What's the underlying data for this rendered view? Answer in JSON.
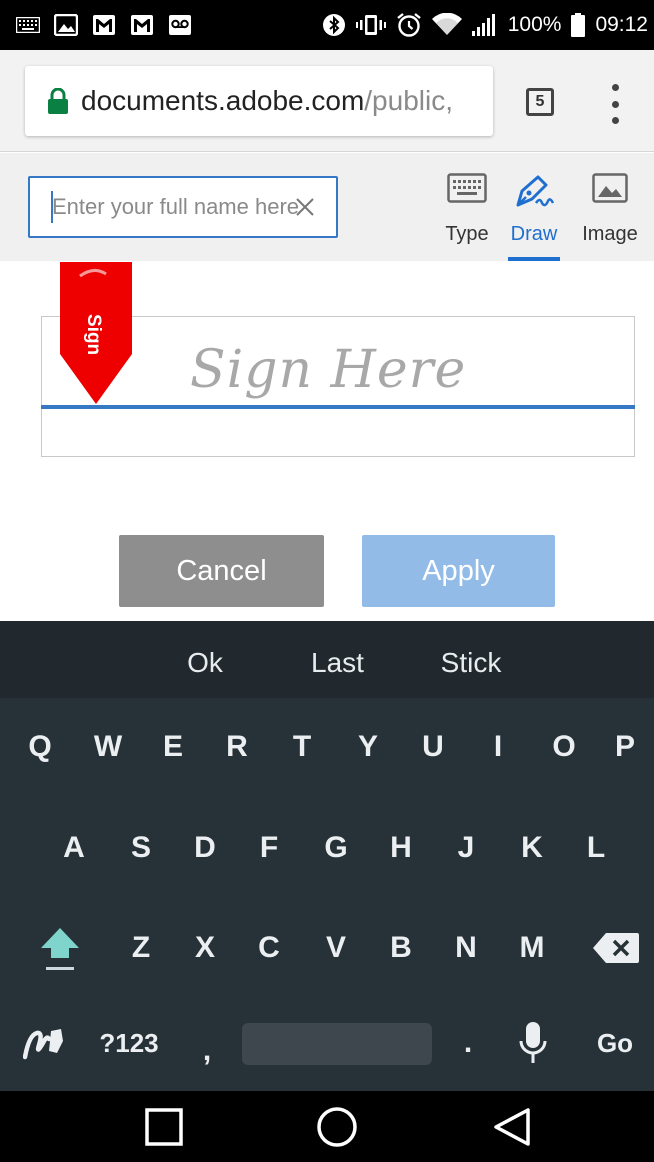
{
  "status_bar": {
    "battery_percent": "100%",
    "time": "09:12",
    "left_icons": [
      "keyboard-icon",
      "image-icon",
      "gmail-icon",
      "gmail-icon",
      "voicemail-icon"
    ],
    "right_icons": [
      "bluetooth-icon",
      "vibrate-icon",
      "alarm-icon",
      "wifi-icon",
      "signal-icon",
      "battery-icon"
    ]
  },
  "browser": {
    "url_host": "documents.adobe.com",
    "url_path": "/public,",
    "tab_count": "5"
  },
  "signature_toolbar": {
    "name_placeholder": "Enter your full name here",
    "modes": [
      {
        "label": "Type",
        "icon": "keyboard-icon",
        "active": false
      },
      {
        "label": "Draw",
        "icon": "pen-icon",
        "active": true
      },
      {
        "label": "Image",
        "icon": "image-icon",
        "active": false
      }
    ]
  },
  "signature_area": {
    "ribbon_label": "Sign",
    "placeholder_text": "Sign Here"
  },
  "buttons": {
    "cancel_label": "Cancel",
    "apply_label": "Apply"
  },
  "keyboard": {
    "suggestions": [
      "Ok",
      "Last",
      "Stick"
    ],
    "row1": [
      "Q",
      "W",
      "E",
      "R",
      "T",
      "Y",
      "U",
      "I",
      "O",
      "P"
    ],
    "row2": [
      "A",
      "S",
      "D",
      "F",
      "G",
      "H",
      "J",
      "K",
      "L"
    ],
    "row3": [
      "Z",
      "X",
      "C",
      "V",
      "B",
      "N",
      "M"
    ],
    "symbols_label": "?123",
    "comma": ",",
    "period": ".",
    "go_label": "Go"
  },
  "colors": {
    "accent_blue": "#1e6fcf",
    "ribbon_red": "#ee0000",
    "keyboard_bg": "#263238",
    "shift_teal": "#7fd4cb"
  }
}
